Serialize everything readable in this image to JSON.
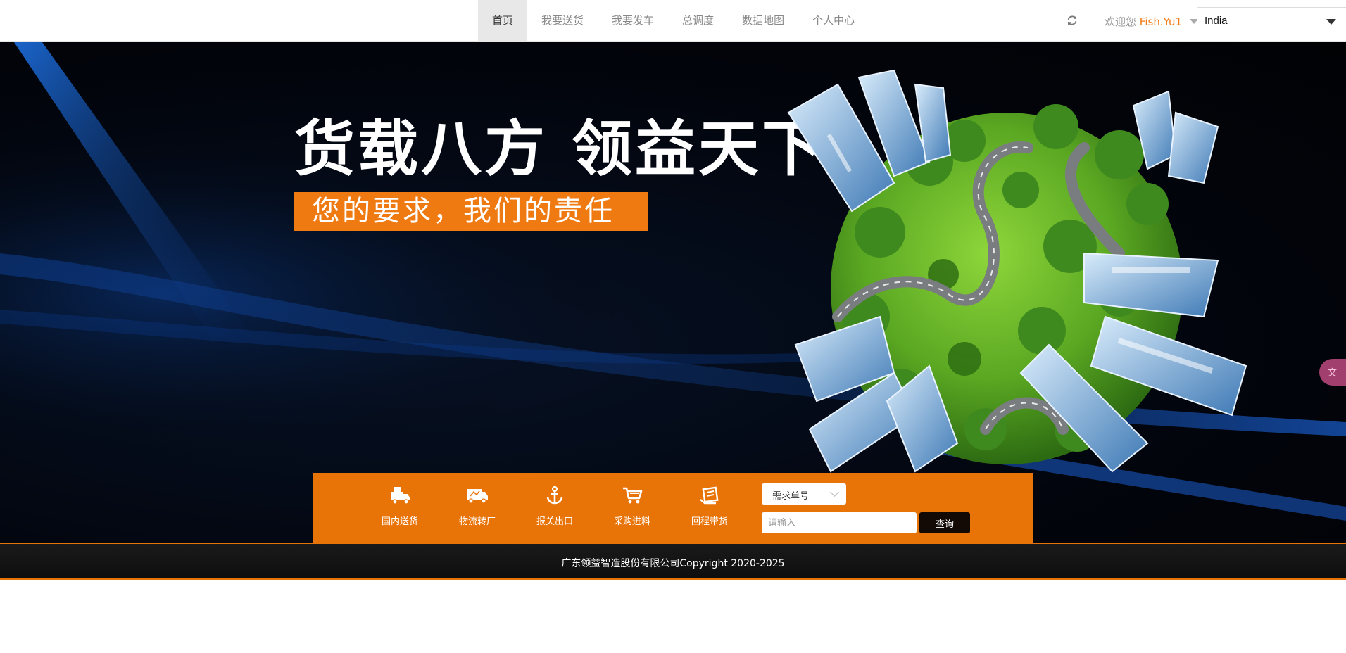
{
  "nav": {
    "items": [
      {
        "label": "首页",
        "active": true
      },
      {
        "label": "我要送货",
        "active": false
      },
      {
        "label": "我要发车",
        "active": false
      },
      {
        "label": "总调度",
        "active": false
      },
      {
        "label": "数据地图",
        "active": false
      },
      {
        "label": "个人中心",
        "active": false
      }
    ],
    "refresh_icon": "refresh-icon",
    "welcome_prefix": "欢迎您",
    "username": "Fish.Yu1",
    "language": "India"
  },
  "hero": {
    "headline": "货载八方 领益天下",
    "tagline": "您的要求，我们的责任"
  },
  "services": [
    {
      "label": "国内送货",
      "icon": "delivery-truck-icon"
    },
    {
      "label": "物流转厂",
      "icon": "transfer-truck-icon"
    },
    {
      "label": "报关出口",
      "icon": "anchor-icon"
    },
    {
      "label": "采购进料",
      "icon": "shopping-cart-icon"
    },
    {
      "label": "回程带货",
      "icon": "return-cargo-icon"
    }
  ],
  "search": {
    "type_value": "需求单号",
    "placeholder": "请输入",
    "button_label": "查询"
  },
  "footer": {
    "copyright": "广东领益智造股份有限公司Copyright 2020-2025"
  },
  "colors": {
    "accent": "#e87307",
    "tagline_bg": "#ef7a12",
    "footer_bg": "#141414"
  }
}
